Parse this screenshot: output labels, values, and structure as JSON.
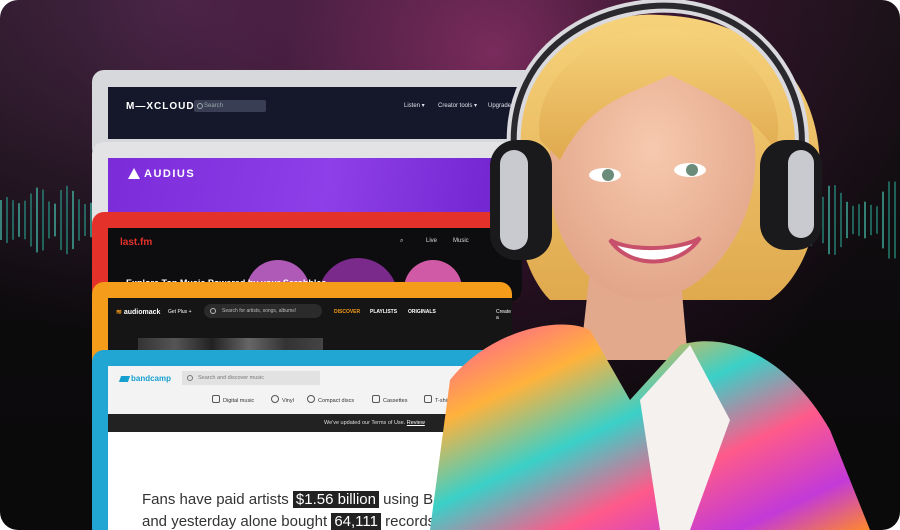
{
  "mixcloud": {
    "logo": "M—XCLOUD",
    "search_placeholder": "Search",
    "nav": [
      "Listen",
      "Creator tools",
      "Upgrade"
    ]
  },
  "audius": {
    "logo": "AUDIUS"
  },
  "lastfm": {
    "logo": "last.fm",
    "nav": [
      "Live",
      "Music"
    ],
    "headline": "Explore Top Music Powered by your Scrobbles"
  },
  "audiomack": {
    "logo": "audiomack",
    "get_plus": "Get Plus +",
    "search_placeholder": "Search for artists, songs, albums!",
    "nav": [
      "DISCOVER",
      "PLAYLISTS",
      "ORIGINALS"
    ],
    "create": "Create a"
  },
  "bandcamp": {
    "logo": "bandcamp",
    "search_placeholder": "Search and discover music",
    "categories": [
      "Digital music",
      "Vinyl",
      "Compact discs",
      "Cassettes",
      "T-shirts"
    ],
    "notice_text": "We've updated our Terms of Use.",
    "notice_link": "Review",
    "hero": {
      "line1_a": "Fans have paid artists",
      "amount": "$1.56 billion",
      "line1_b": "using Ban",
      "line2_a": "and yesterday alone bought",
      "count": "64,111",
      "line2_b": "records."
    }
  }
}
